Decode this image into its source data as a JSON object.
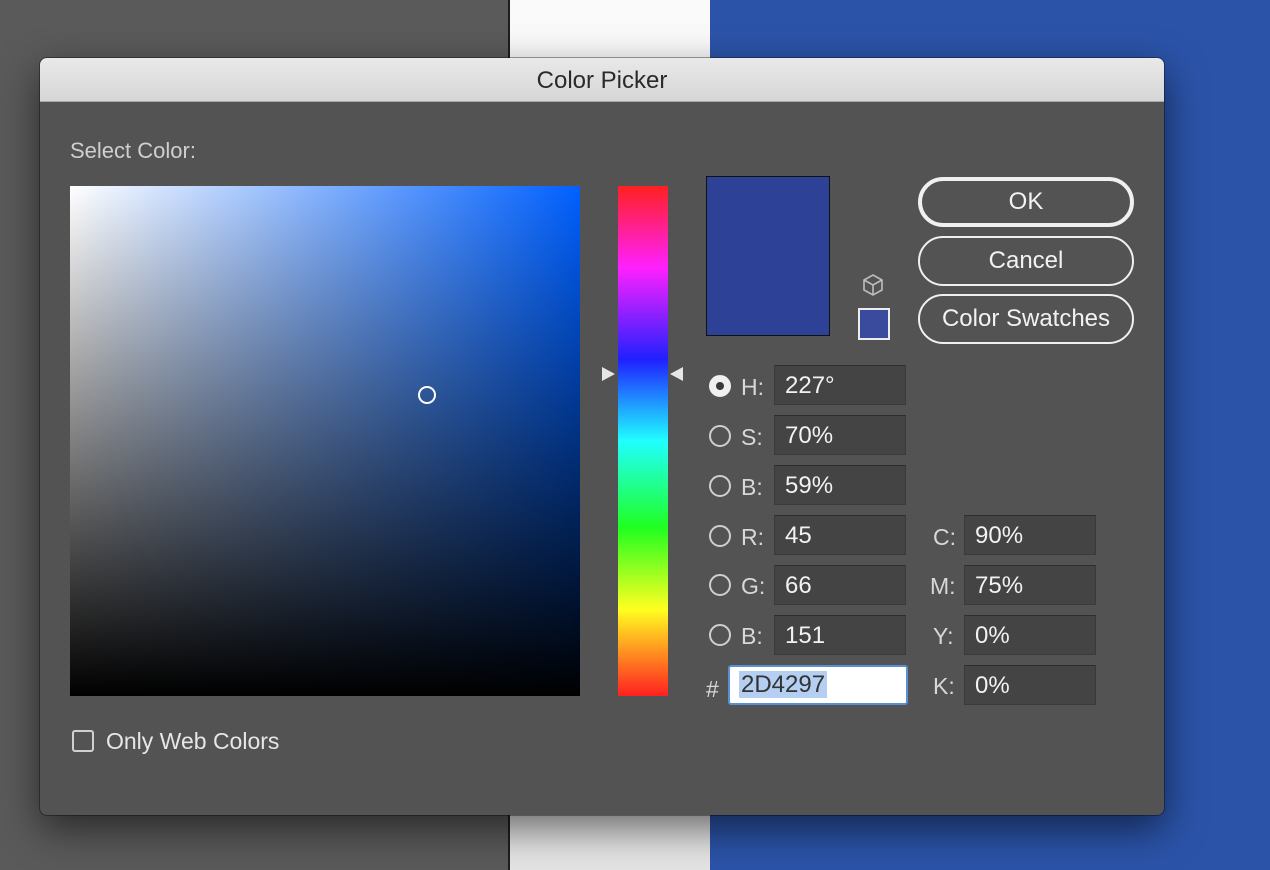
{
  "window": {
    "title": "Color Picker"
  },
  "picker": {
    "select_label": "Select Color:",
    "current_color_hex": "#2D4297",
    "field_cursor": {
      "saturation_pct": 70,
      "brightness_pct": 59
    },
    "hue_deg": 227
  },
  "buttons": {
    "ok": "OK",
    "cancel": "Cancel",
    "swatches": "Color Swatches"
  },
  "hsb": {
    "h": {
      "label": "H:",
      "value": "227°",
      "selected": true
    },
    "s": {
      "label": "S:",
      "value": "70%"
    },
    "b": {
      "label": "B:",
      "value": "59%"
    }
  },
  "rgb": {
    "r": {
      "label": "R:",
      "value": "45"
    },
    "g": {
      "label": "G:",
      "value": "66"
    },
    "b": {
      "label": "B:",
      "value": "151"
    }
  },
  "cmyk": {
    "c": {
      "label": "C:",
      "value": "90%"
    },
    "m": {
      "label": "M:",
      "value": "75%"
    },
    "y": {
      "label": "Y:",
      "value": "0%"
    },
    "k": {
      "label": "K:",
      "value": "0%"
    }
  },
  "hex": {
    "prefix": "#",
    "value": "2D4297"
  },
  "web_colors": {
    "label": "Only Web Colors",
    "checked": false
  },
  "colors": {
    "preview": "#2D4297",
    "web_safe_swatch": "#3A4A9C",
    "background_blue": "#2B53A8"
  }
}
